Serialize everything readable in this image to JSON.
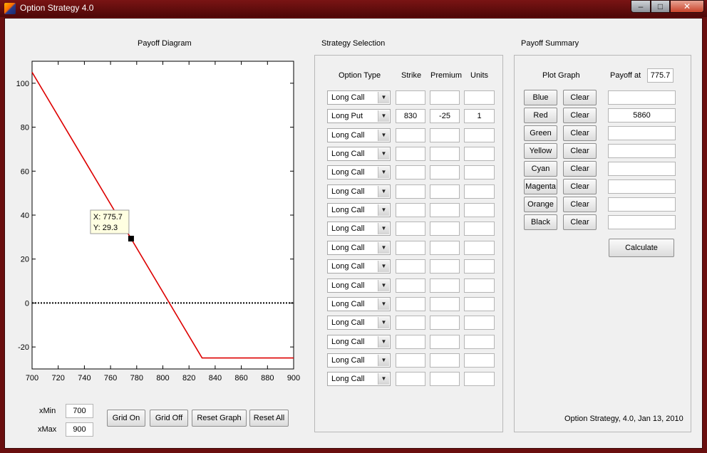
{
  "window": {
    "title": "Option Strategy 4.0"
  },
  "payoff_diagram": {
    "title": "Payoff Diagram",
    "tooltip": {
      "x_text": "X: 775.7",
      "y_text": "Y: 29.3"
    },
    "xmin_label": "xMin",
    "xmin_value": "700",
    "xmax_label": "xMax",
    "xmax_value": "900",
    "buttons": {
      "grid_on": "Grid On",
      "grid_off": "Grid Off",
      "reset_graph": "Reset Graph",
      "reset_all": "Reset All"
    }
  },
  "chart_data": {
    "type": "line",
    "title": "",
    "xlabel": "",
    "ylabel": "",
    "xlim": [
      700,
      900
    ],
    "ylim": [
      -30,
      110
    ],
    "xticks": [
      700,
      720,
      740,
      760,
      780,
      800,
      820,
      840,
      860,
      880,
      900
    ],
    "yticks": [
      -20,
      0,
      20,
      40,
      60,
      80,
      100
    ],
    "grid": false,
    "series": [
      {
        "color": "#dd0000",
        "x": [
          700,
          830,
          900
        ],
        "y": [
          105,
          -25,
          -25
        ]
      }
    ],
    "reference_line": {
      "y": 0,
      "style": "dotted",
      "color": "#000000"
    },
    "datatip": {
      "x": 775.7,
      "y": 29.3
    }
  },
  "strategy": {
    "title": "Strategy Selection",
    "headers": {
      "option_type": "Option Type",
      "strike": "Strike",
      "premium": "Premium",
      "units": "Units"
    },
    "rows": [
      {
        "type": "Long Call",
        "strike": "",
        "premium": "",
        "units": ""
      },
      {
        "type": "Long Put",
        "strike": "830",
        "premium": "-25",
        "units": "1"
      },
      {
        "type": "Long Call",
        "strike": "",
        "premium": "",
        "units": ""
      },
      {
        "type": "Long Call",
        "strike": "",
        "premium": "",
        "units": ""
      },
      {
        "type": "Long Call",
        "strike": "",
        "premium": "",
        "units": ""
      },
      {
        "type": "Long Call",
        "strike": "",
        "premium": "",
        "units": ""
      },
      {
        "type": "Long Call",
        "strike": "",
        "premium": "",
        "units": ""
      },
      {
        "type": "Long Call",
        "strike": "",
        "premium": "",
        "units": ""
      },
      {
        "type": "Long Call",
        "strike": "",
        "premium": "",
        "units": ""
      },
      {
        "type": "Long Call",
        "strike": "",
        "premium": "",
        "units": ""
      },
      {
        "type": "Long Call",
        "strike": "",
        "premium": "",
        "units": ""
      },
      {
        "type": "Long Call",
        "strike": "",
        "premium": "",
        "units": ""
      },
      {
        "type": "Long Call",
        "strike": "",
        "premium": "",
        "units": ""
      },
      {
        "type": "Long Call",
        "strike": "",
        "premium": "",
        "units": ""
      },
      {
        "type": "Long Call",
        "strike": "",
        "premium": "",
        "units": ""
      },
      {
        "type": "Long Call",
        "strike": "",
        "premium": "",
        "units": ""
      }
    ]
  },
  "summary": {
    "title": "Payoff Summary",
    "plot_graph_label": "Plot Graph",
    "payoff_at_label": "Payoff at",
    "payoff_at_value": "775.7",
    "rows": [
      {
        "color": "Blue",
        "clear": "Clear",
        "value": ""
      },
      {
        "color": "Red",
        "clear": "Clear",
        "value": "5860"
      },
      {
        "color": "Green",
        "clear": "Clear",
        "value": ""
      },
      {
        "color": "Yellow",
        "clear": "Clear",
        "value": ""
      },
      {
        "color": "Cyan",
        "clear": "Clear",
        "value": ""
      },
      {
        "color": "Magenta",
        "clear": "Clear",
        "value": ""
      },
      {
        "color": "Orange",
        "clear": "Clear",
        "value": ""
      },
      {
        "color": "Black",
        "clear": "Clear",
        "value": ""
      }
    ],
    "calculate": "Calculate",
    "footer": "Option Strategy, 4.0, Jan 13, 2010"
  }
}
